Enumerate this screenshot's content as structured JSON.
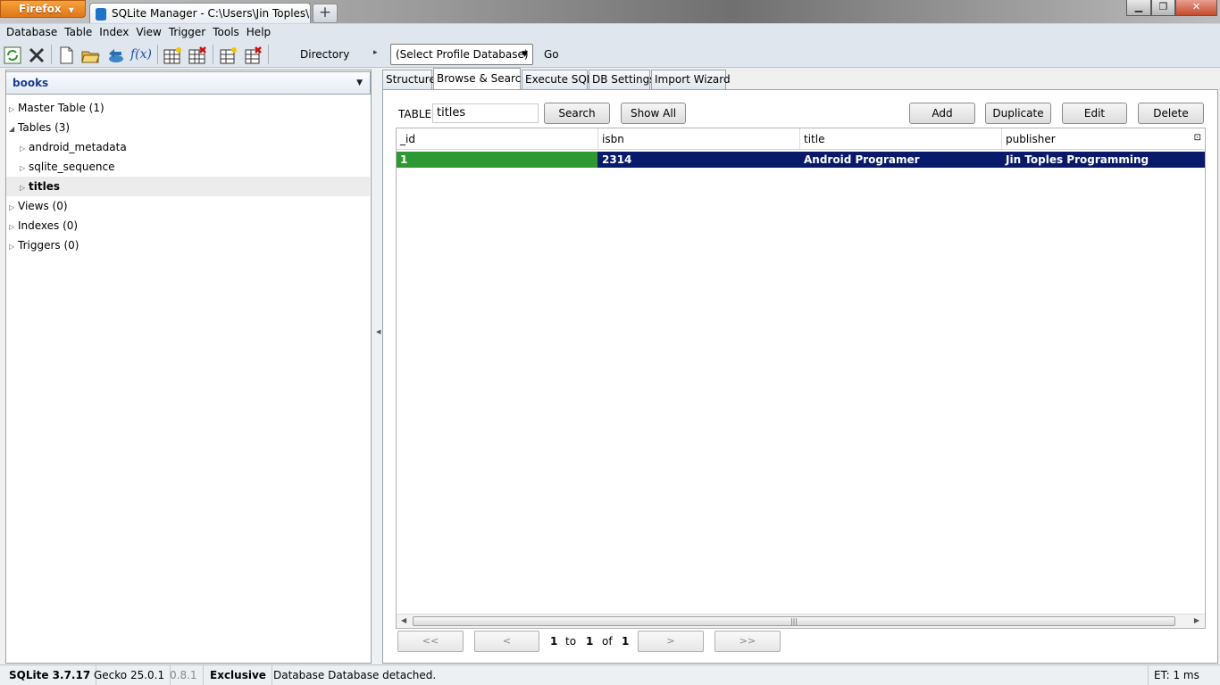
{
  "browser": {
    "app_button": "Firefox",
    "tab_title": "SQLite Manager - C:\\Users\\Jin Toples\\w...",
    "new_tab": "+",
    "win_minimize": "▁",
    "win_restore": "❐",
    "win_close": "✕"
  },
  "menu": [
    "Database",
    "Table",
    "Index",
    "View",
    "Trigger",
    "Tools",
    "Help"
  ],
  "toolbar": {
    "icons": [
      "refresh-icon",
      "tools-icon",
      "new-db-icon",
      "open-db-icon",
      "connect-db-icon",
      "function-icon",
      "create-table-icon",
      "drop-table-icon",
      "create-index-icon",
      "drop-index-icon"
    ],
    "function_glyph": "f(x)",
    "directory_label": "Directory",
    "directory_arrow": "▸",
    "profile_select": "(Select Profile Database)",
    "go_label": "Go"
  },
  "sidebar": {
    "database": "books",
    "tree": [
      {
        "label": "Master Table (1)",
        "level": 0,
        "expanded": false,
        "selected": false
      },
      {
        "label": "Tables (3)",
        "level": 0,
        "expanded": true,
        "selected": false
      },
      {
        "label": "android_metadata",
        "level": 1,
        "expanded": false,
        "selected": false
      },
      {
        "label": "sqlite_sequence",
        "level": 1,
        "expanded": false,
        "selected": false
      },
      {
        "label": "titles",
        "level": 1,
        "expanded": false,
        "selected": true
      },
      {
        "label": "Views (0)",
        "level": 0,
        "expanded": false,
        "selected": false
      },
      {
        "label": "Indexes (0)",
        "level": 0,
        "expanded": false,
        "selected": false
      },
      {
        "label": "Triggers (0)",
        "level": 0,
        "expanded": false,
        "selected": false
      }
    ]
  },
  "tabs": [
    {
      "label": "Structure",
      "active": false
    },
    {
      "label": "Browse & Search",
      "active": true
    },
    {
      "label": "Execute SQL",
      "active": false
    },
    {
      "label": "DB Settings",
      "active": false
    },
    {
      "label": "Import Wizard",
      "active": false
    }
  ],
  "browse": {
    "table_label": "TABLE",
    "table_value": "titles",
    "search_button": "Search",
    "show_all_button": "Show All",
    "add_button": "Add",
    "duplicate_button": "Duplicate",
    "edit_button": "Edit",
    "delete_button": "Delete",
    "columns": [
      "_id",
      "isbn",
      "title",
      "publisher"
    ],
    "rows": [
      [
        "1",
        "2314",
        "Android Programer",
        "Jin Toples Programming"
      ]
    ],
    "pager": {
      "first": "<<",
      "prev": "<",
      "next": ">",
      "last": ">>",
      "from": "1",
      "to_label": "to",
      "to": "1",
      "of_label": "of",
      "total": "1"
    }
  },
  "status": {
    "sqlite_version": "SQLite 3.7.17",
    "gecko_version": "Gecko 25.0.1",
    "ext_version": "0.8.1",
    "mode": "Exclusive",
    "message": "Database Database detached.",
    "timer": "ET: 1 ms"
  },
  "colors": {
    "selected_row": "#0a1a6b",
    "id_cell": "#2e9933",
    "firefox_orange": "#e0761a"
  }
}
